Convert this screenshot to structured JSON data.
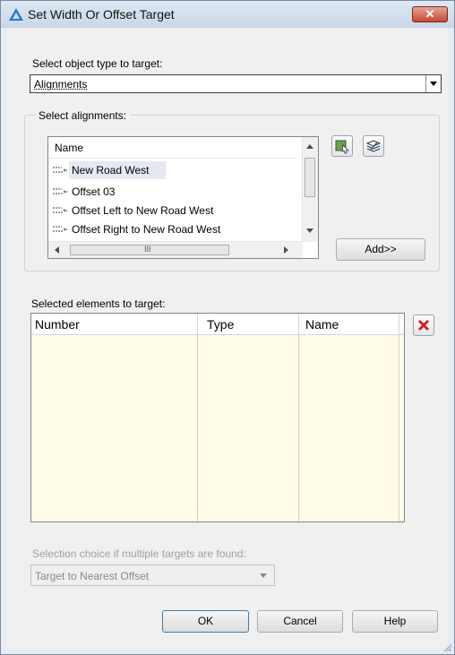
{
  "window": {
    "title": "Set Width Or Offset Target",
    "close_label": "✕"
  },
  "object_type": {
    "label": "Select object type to target:",
    "selected": "Alignments"
  },
  "alignments": {
    "group_label": "Select alignments:",
    "column_name": "Name",
    "items": [
      {
        "name": "New Road West"
      },
      {
        "name": "Offset 03"
      },
      {
        "name": "Offset Left to New Road West"
      },
      {
        "name": "Offset Right to New Road West"
      }
    ],
    "hscroll_thumb_label": "III",
    "add_button": "Add>>"
  },
  "targets": {
    "label": "Selected elements to target:",
    "columns": [
      "Number",
      "Type",
      "Name"
    ]
  },
  "selection_choice": {
    "label": "Selection choice if multiple targets are found:",
    "selected": "Target to Nearest Offset"
  },
  "buttons": {
    "ok": "OK",
    "cancel": "Cancel",
    "help": "Help"
  },
  "colors": {
    "accent": "#3c7fb1",
    "grid_bg": "#fffde8",
    "close": "#c74a33"
  }
}
